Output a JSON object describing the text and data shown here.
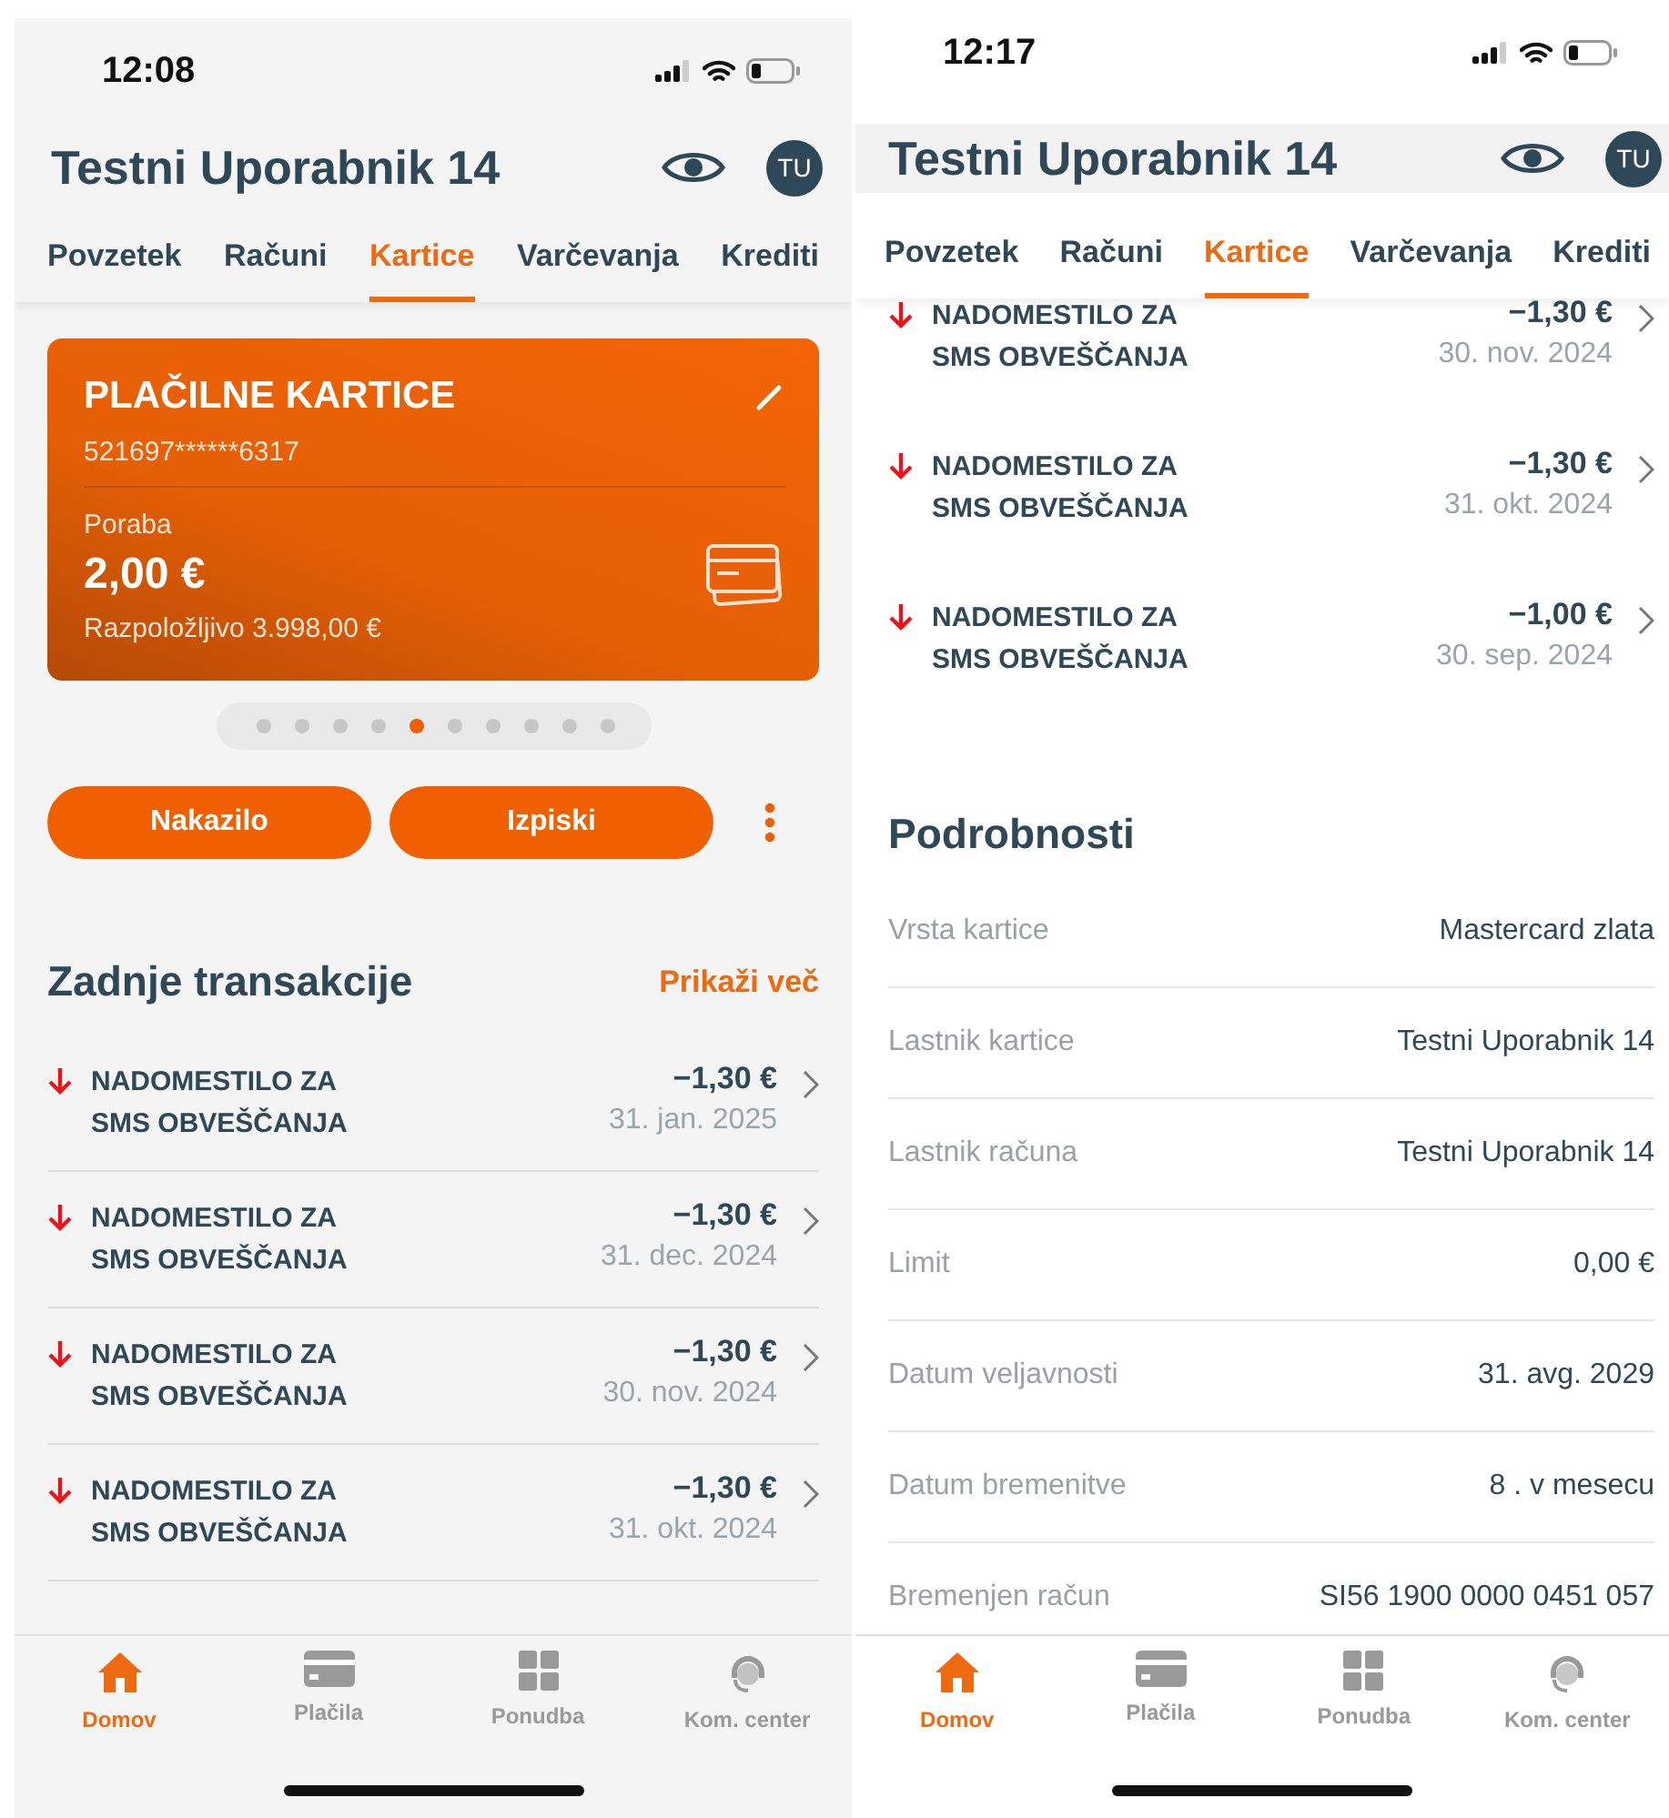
{
  "screens": [
    {
      "status_time": "12:08",
      "title": "Testni Uporabnik 14",
      "avatar": "TU",
      "tabs": [
        {
          "label": "Povzetek",
          "selected": false
        },
        {
          "label": "Računi",
          "selected": false
        },
        {
          "label": "Kartice",
          "selected": true
        },
        {
          "label": "Varčevanja",
          "selected": false
        },
        {
          "label": "Krediti",
          "selected": false
        }
      ],
      "card": {
        "title": "PLAČILNE KARTICE",
        "number": "521697******6317",
        "spending_label": "Poraba",
        "spending": "2,00 €",
        "available": "Razpoložljivo 3.998,00 €"
      },
      "pager": [
        {
          "selected": false
        },
        {
          "selected": false
        },
        {
          "selected": false
        },
        {
          "selected": false
        },
        {
          "selected": true
        },
        {
          "selected": false
        },
        {
          "selected": false
        },
        {
          "selected": false
        },
        {
          "selected": false
        },
        {
          "selected": false
        }
      ],
      "actions": [
        "Nakazilo",
        "Izpiski"
      ],
      "transactions_heading": "Zadnje transakcije",
      "show_more": "Prikaži več",
      "transactions": [
        {
          "name": "NADOMESTILO ZA SMS OBVEŠČANJA",
          "amount": "−1,30 €",
          "date": "31. jan. 2025"
        },
        {
          "name": "NADOMESTILO ZA SMS OBVEŠČANJA",
          "amount": "−1,30 €",
          "date": "31. dec. 2024"
        },
        {
          "name": "NADOMESTILO ZA SMS OBVEŠČANJA",
          "amount": "−1,30 €",
          "date": "30. nov. 2024"
        },
        {
          "name": "NADOMESTILO ZA SMS OBVEŠČANJA",
          "amount": "−1,30 €",
          "date": "31. okt. 2024"
        }
      ],
      "nav": [
        {
          "label": "Domov",
          "kind": "home",
          "selected": true
        },
        {
          "label": "Plačila",
          "kind": "payments",
          "selected": false
        },
        {
          "label": "Ponudba",
          "kind": "offer",
          "selected": false
        },
        {
          "label": "Kom. center",
          "kind": "contact",
          "selected": false
        }
      ]
    },
    {
      "status_time": "12:17",
      "title": "Testni Uporabnik 14",
      "avatar": "TU",
      "tabs": [
        {
          "label": "Povzetek",
          "selected": false
        },
        {
          "label": "Računi",
          "selected": false
        },
        {
          "label": "Kartice",
          "selected": true
        },
        {
          "label": "Varčevanja",
          "selected": false
        },
        {
          "label": "Krediti",
          "selected": false
        }
      ],
      "transactions": [
        {
          "name": "NADOMESTILO ZA SMS OBVEŠČANJA",
          "amount": "−1,30 €",
          "date": "30. nov. 2024"
        },
        {
          "name": "NADOMESTILO ZA SMS OBVEŠČANJA",
          "amount": "−1,30 €",
          "date": "31. okt. 2024"
        },
        {
          "name": "NADOMESTILO ZA SMS OBVEŠČANJA",
          "amount": "−1,00 €",
          "date": "30. sep. 2024"
        }
      ],
      "details_heading": "Podrobnosti",
      "details": [
        {
          "label": "Vrsta kartice",
          "value": "Mastercard zlata"
        },
        {
          "label": "Lastnik kartice",
          "value": "Testni Uporabnik 14"
        },
        {
          "label": "Lastnik računa",
          "value": "Testni Uporabnik 14"
        },
        {
          "label": "Limit",
          "value": "0,00 €"
        },
        {
          "label": "Datum veljavnosti",
          "value": "31. avg. 2029"
        },
        {
          "label": "Datum bremenitve",
          "value": "8 . v mesecu"
        },
        {
          "label": "Bremenjen račun",
          "value": "SI56 1900 0000 0451 057"
        }
      ],
      "nav": [
        {
          "label": "Domov",
          "kind": "home",
          "selected": true
        },
        {
          "label": "Plačila",
          "kind": "payments",
          "selected": false
        },
        {
          "label": "Ponudba",
          "kind": "offer",
          "selected": false
        },
        {
          "label": "Kom. center",
          "kind": "contact",
          "selected": false
        }
      ]
    }
  ]
}
